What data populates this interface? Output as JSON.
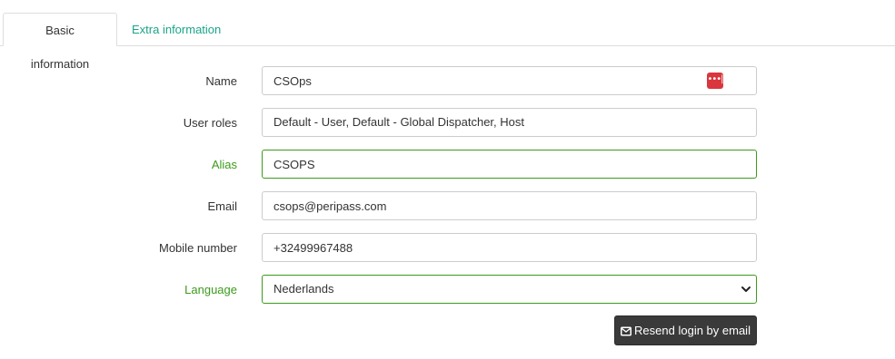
{
  "tabs": {
    "basic": "Basic information",
    "extra": "Extra information"
  },
  "form": {
    "name": {
      "label": "Name",
      "value": "CSOps"
    },
    "roles": {
      "label": "User roles",
      "value": "Default - User, Default - Global Dispatcher, Host"
    },
    "alias": {
      "label": "Alias",
      "value": "CSOPS"
    },
    "email": {
      "label": "Email",
      "value": "csops@peripass.com"
    },
    "mobile": {
      "label": "Mobile number",
      "value": "+32499967488"
    },
    "language": {
      "label": "Language",
      "value": "Nederlands"
    }
  },
  "actions": {
    "resend_label": "Resend login by email"
  },
  "icons": {
    "password_manager": "password-manager-icon",
    "mail": "envelope-icon",
    "select": "chevron-down-icon"
  },
  "colors": {
    "tab_link": "#1aa58a",
    "valid": "#3c9a1c",
    "button_bg": "#3a3a3a",
    "badge": "#d9363e"
  }
}
